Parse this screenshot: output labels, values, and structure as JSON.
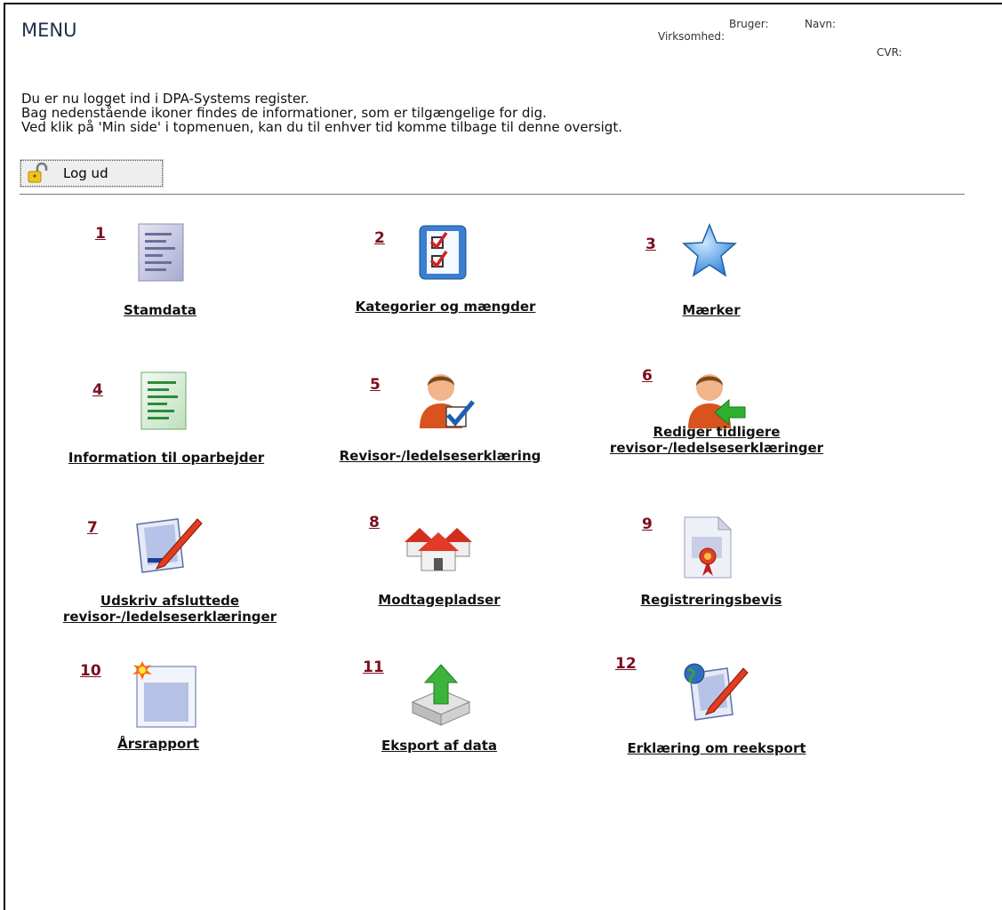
{
  "header": {
    "title": "MENU",
    "user_label": "Bruger:",
    "name_label": "Navn:",
    "company_label": "Virksomhed:",
    "cvr_label": "CVR:"
  },
  "intro": {
    "line1": "Du er nu logget ind i DPA-Systems register.",
    "line2": "Bag nedenstående ikoner findes de informationer, som er tilgængelige for dig.",
    "line3": "Ved klik på 'Min side' i topmenuen, kan du til enhver tid komme tilbage til denne oversigt."
  },
  "logout": {
    "label": "Log ud",
    "icon": "padlock-icon"
  },
  "menu_items": [
    {
      "num": "1",
      "label": "Stamdata",
      "icon": "document-lines-icon"
    },
    {
      "num": "2",
      "label": "Kategorier og mængder",
      "icon": "checklist-icon"
    },
    {
      "num": "3",
      "label": "Mærker",
      "icon": "star-icon"
    },
    {
      "num": "4",
      "label": "Information til oparbejder",
      "icon": "green-document-icon"
    },
    {
      "num": "5",
      "label": "Revisor-/ledelseserklæring",
      "icon": "user-check-icon"
    },
    {
      "num": "6",
      "label_line1": "Rediger tidligere",
      "label_line2": "revisor-/ledelseserklæringer",
      "icon": "user-back-arrow-icon"
    },
    {
      "num": "7",
      "label_line1": "Udskriv afsluttede",
      "label_line2": "revisor-/ledelseserklæringer",
      "icon": "document-pen-icon"
    },
    {
      "num": "8",
      "label": "Modtagepladser",
      "icon": "houses-icon"
    },
    {
      "num": "9",
      "label": "Registreringsbevis",
      "icon": "certificate-icon"
    },
    {
      "num": "10",
      "label": "Årsrapport",
      "icon": "new-window-icon"
    },
    {
      "num": "11",
      "label": "Eksport af data",
      "icon": "export-arrow-icon"
    },
    {
      "num": "12",
      "label": "Erklæring om reeksport",
      "icon": "globe-document-pen-icon"
    }
  ]
}
